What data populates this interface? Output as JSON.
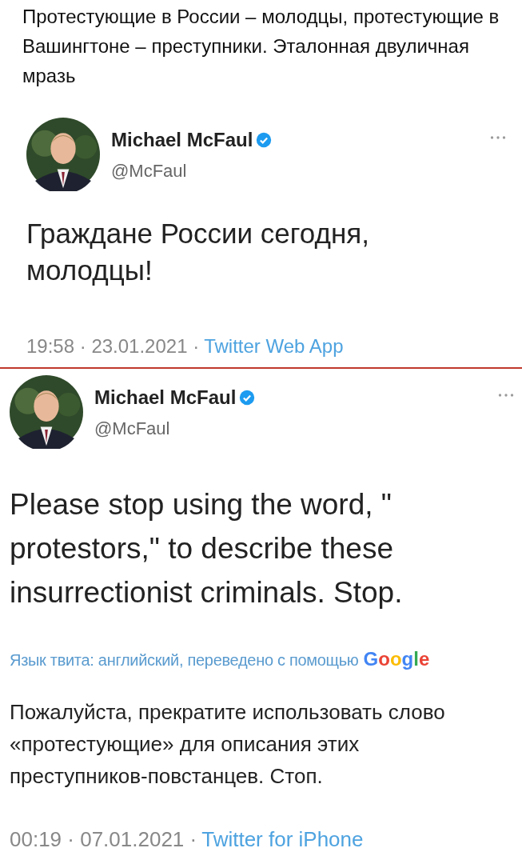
{
  "caption": "Протестующие в России – молодцы, протестующие в Вашингтоне – преступники. Эталонная двуличная мразь",
  "tweets": [
    {
      "author": {
        "name": "Michael McFaul",
        "handle": "@McFaul",
        "verified": true
      },
      "text": "Граждане России сегодня, молодцы!",
      "meta": {
        "timestamp": "19:58 · 23.01.2021 ·",
        "source": "Twitter Web App"
      }
    },
    {
      "author": {
        "name": "Michael McFaul",
        "handle": "@McFaul",
        "verified": true
      },
      "text": "Please stop using the word, \" protestors,\" to describe these insurrectionist criminals. Stop.",
      "translation": {
        "note": "Язык твита: английский, переведено с помощью",
        "brand": "Google",
        "text": "Пожалуйста, прекратите использовать слово «протестующие» для описания этих преступников-повстанцев. Стоп."
      },
      "meta": {
        "timestamp": "00:19 · 07.01.2021 ·",
        "source": "Twitter for iPhone"
      }
    }
  ]
}
